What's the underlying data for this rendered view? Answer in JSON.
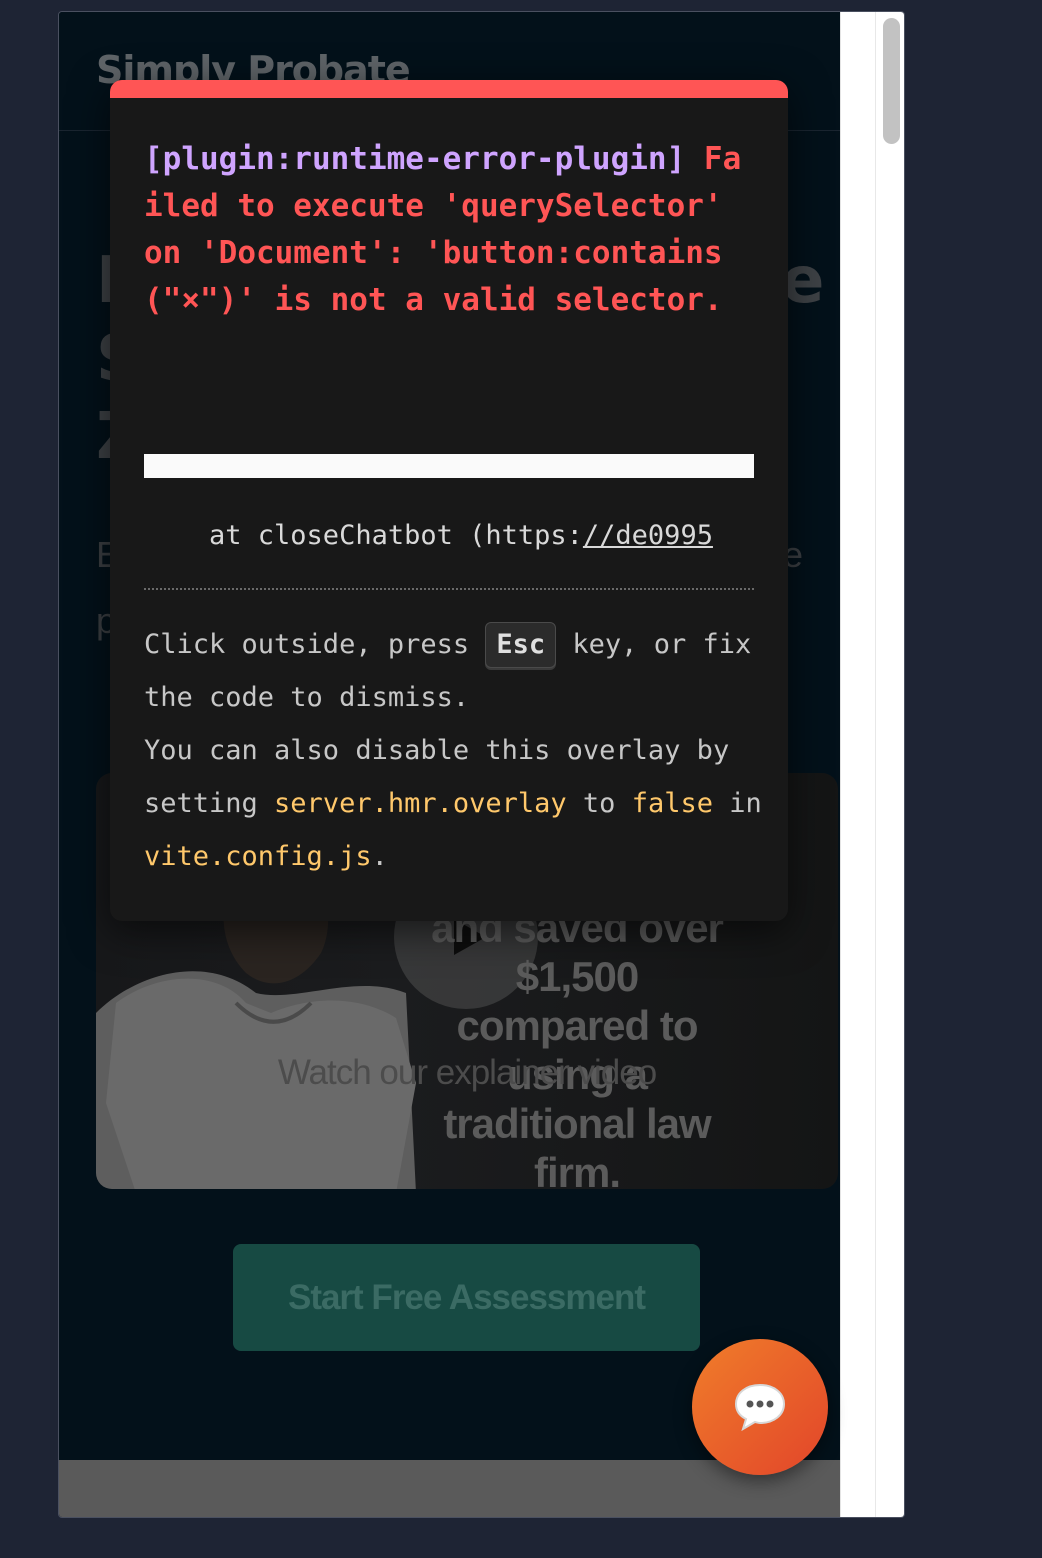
{
  "site": {
    "brand": "Simply Probate",
    "hero_ghost_left": [
      "I",
      "S",
      "Z"
    ],
    "hero_ghost_right": "e",
    "sub_ghost_left": [
      "E",
      "p"
    ],
    "sub_ghost_right": "e",
    "video": {
      "quote": "and saved over $1,500 compared to using a traditional law firm.",
      "label": "Watch our explainer video",
      "play_icon": "play-icon"
    },
    "cta_label": "Start Free Assessment",
    "chat_icon": "chat-bubble-icon"
  },
  "overlay": {
    "plugin": "[plugin:runtime-error-plugin]",
    "message": " Failed to execute 'querySelector' on 'Document': 'button:contains(\"×\")' is not a valid selector.",
    "stack_prefix": "    at closeChatbot (https:",
    "stack_url": "//de0995",
    "tip": {
      "t1": "Click outside, press ",
      "key": "Esc",
      "t2": " key, or fix the code to dismiss.",
      "t3": "You can also disable this overlay by setting ",
      "code1": "server.hmr.overlay",
      "t4": " to ",
      "code2": "false",
      "t5": " in ",
      "code3": "vite.config.js",
      "t6": "."
    }
  },
  "colors": {
    "error_red": "#ff5555",
    "plugin_purple": "#cfa4ff",
    "code_yellow": "#ffc86b",
    "cta_green": "#174a43",
    "chat_orange": "#f07d2a"
  }
}
